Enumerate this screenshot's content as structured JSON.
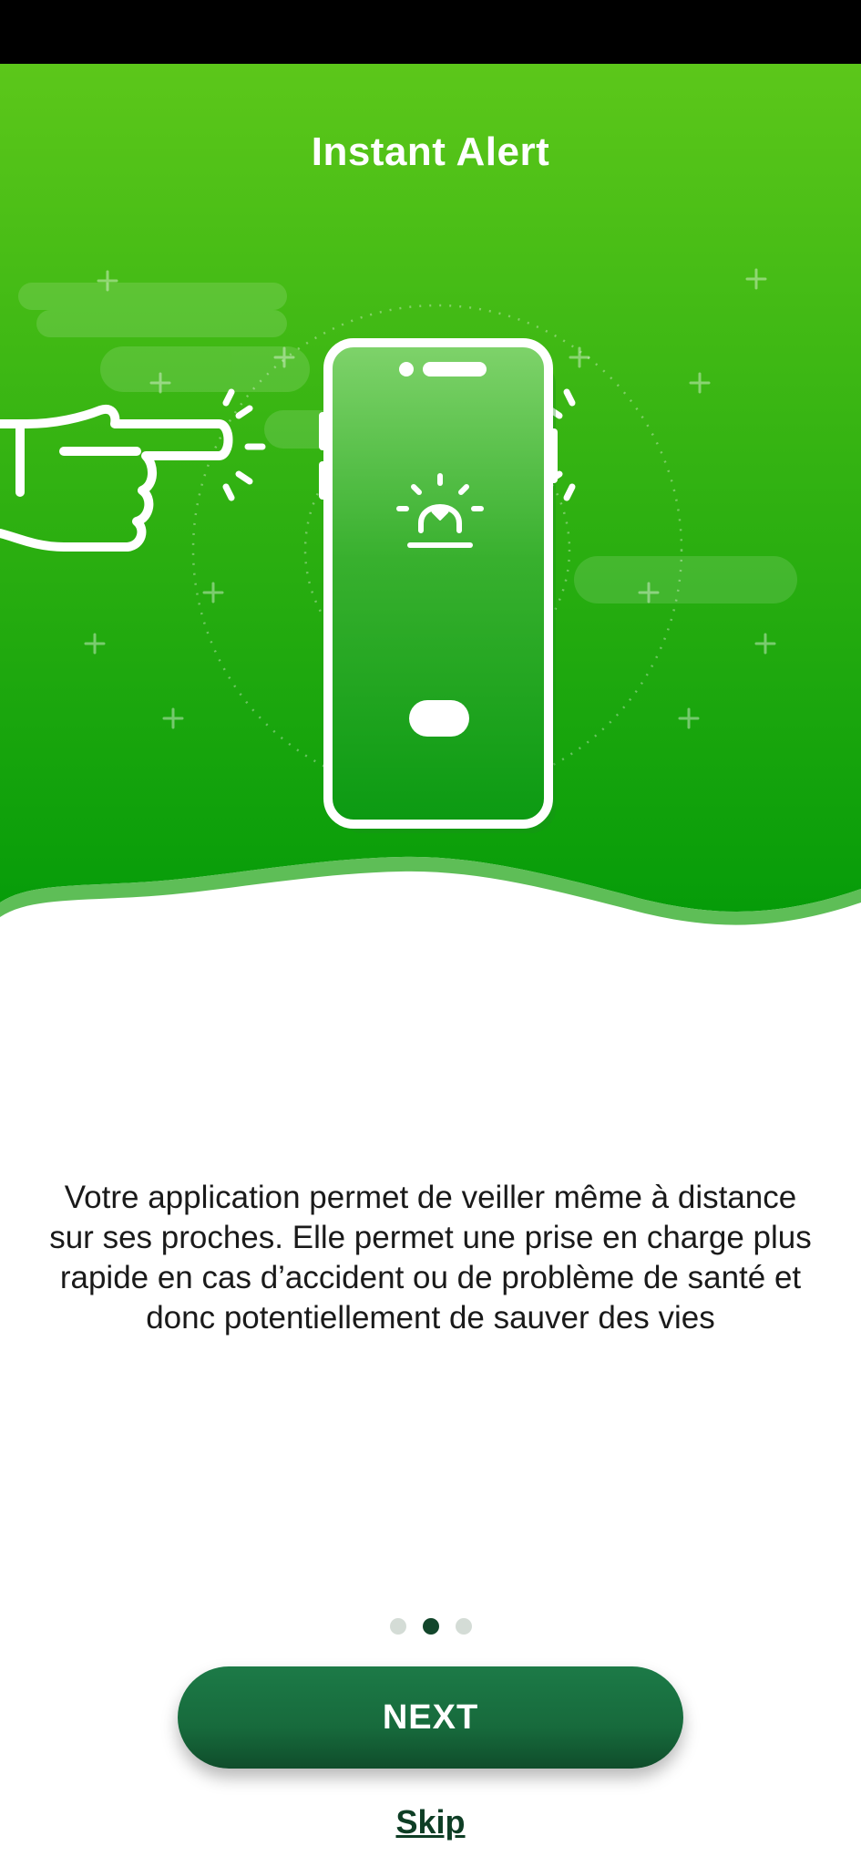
{
  "onboarding": {
    "title": "Instant Alert",
    "description": "Votre application permet de veiller même à distance sur ses proches. Elle permet une prise en charge plus rapide en cas d’accident ou de problème de santé et donc potentiellement de sauver des vies",
    "illustration_icons": [
      "hand-pointing-icon",
      "smartphone-icon",
      "siren-heart-icon"
    ],
    "pagination": {
      "total": 3,
      "current": 2
    },
    "next_label": "NEXT",
    "skip_label": "Skip"
  },
  "colors": {
    "hero_top": "#5cc71a",
    "hero_bottom": "#069c09",
    "button": "#1a7444",
    "dot_active": "#12462b",
    "dot_inactive": "#d4dcd6"
  }
}
